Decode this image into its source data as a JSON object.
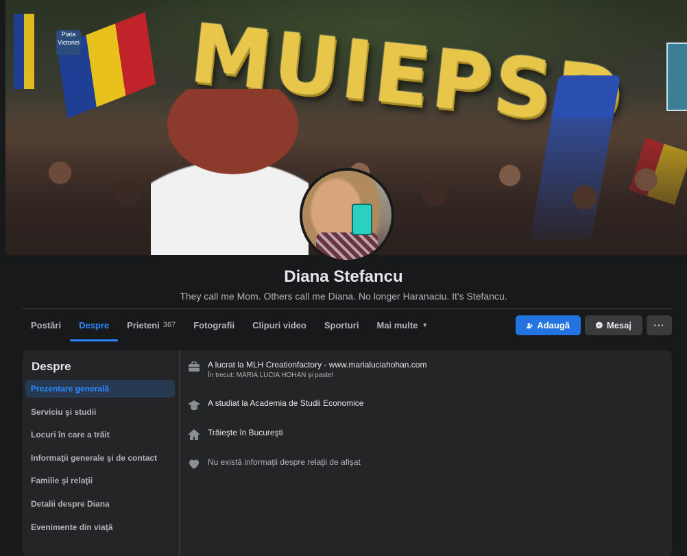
{
  "cover": {
    "balloon_text": "MUIEPSD",
    "street_sign": "Piata Victoriei"
  },
  "profile": {
    "name": "Diana Stefancu",
    "bio": "They call me Mom. Others call me Diana. No longer Haranaciu. It's Stefancu."
  },
  "tabs": [
    {
      "label": "Postări",
      "count": "",
      "active": false
    },
    {
      "label": "Despre",
      "count": "",
      "active": true
    },
    {
      "label": "Prieteni",
      "count": "367",
      "active": false
    },
    {
      "label": "Fotografii",
      "count": "",
      "active": false
    },
    {
      "label": "Clipuri video",
      "count": "",
      "active": false
    },
    {
      "label": "Sporturi",
      "count": "",
      "active": false
    },
    {
      "label": "Mai multe",
      "count": "",
      "active": false
    }
  ],
  "actions": {
    "add_label": "Adaugă",
    "message_label": "Mesaj",
    "more_label": "···"
  },
  "about": {
    "title": "Despre",
    "items": [
      "Prezentare generală",
      "Serviciu şi studii",
      "Locuri în care a trăit",
      "Informaţii generale şi de contact",
      "Familie şi relaţii",
      "Detalii despre Diana",
      "Evenimente din viaţă"
    ]
  },
  "overview": {
    "work": {
      "text": "A lucrat la MLH Creationfactory - www.marialuciahohan.com",
      "sub": "În trecut: MARIA LUCIA HOHAN şi pastel",
      "icon": "briefcase-icon"
    },
    "education": {
      "text": "A studiat la Academia de Studii Economice",
      "icon": "graduation-cap-icon"
    },
    "home": {
      "text": "Trăieşte în Bucureşti",
      "icon": "home-icon"
    },
    "relationship": {
      "text": "Nu există informaţii despre relaţii de afişat",
      "icon": "heart-icon"
    }
  },
  "colors": {
    "accent": "#2d88ff",
    "primary_button": "#2374e1",
    "surface": "#242526",
    "background": "#18191a"
  }
}
